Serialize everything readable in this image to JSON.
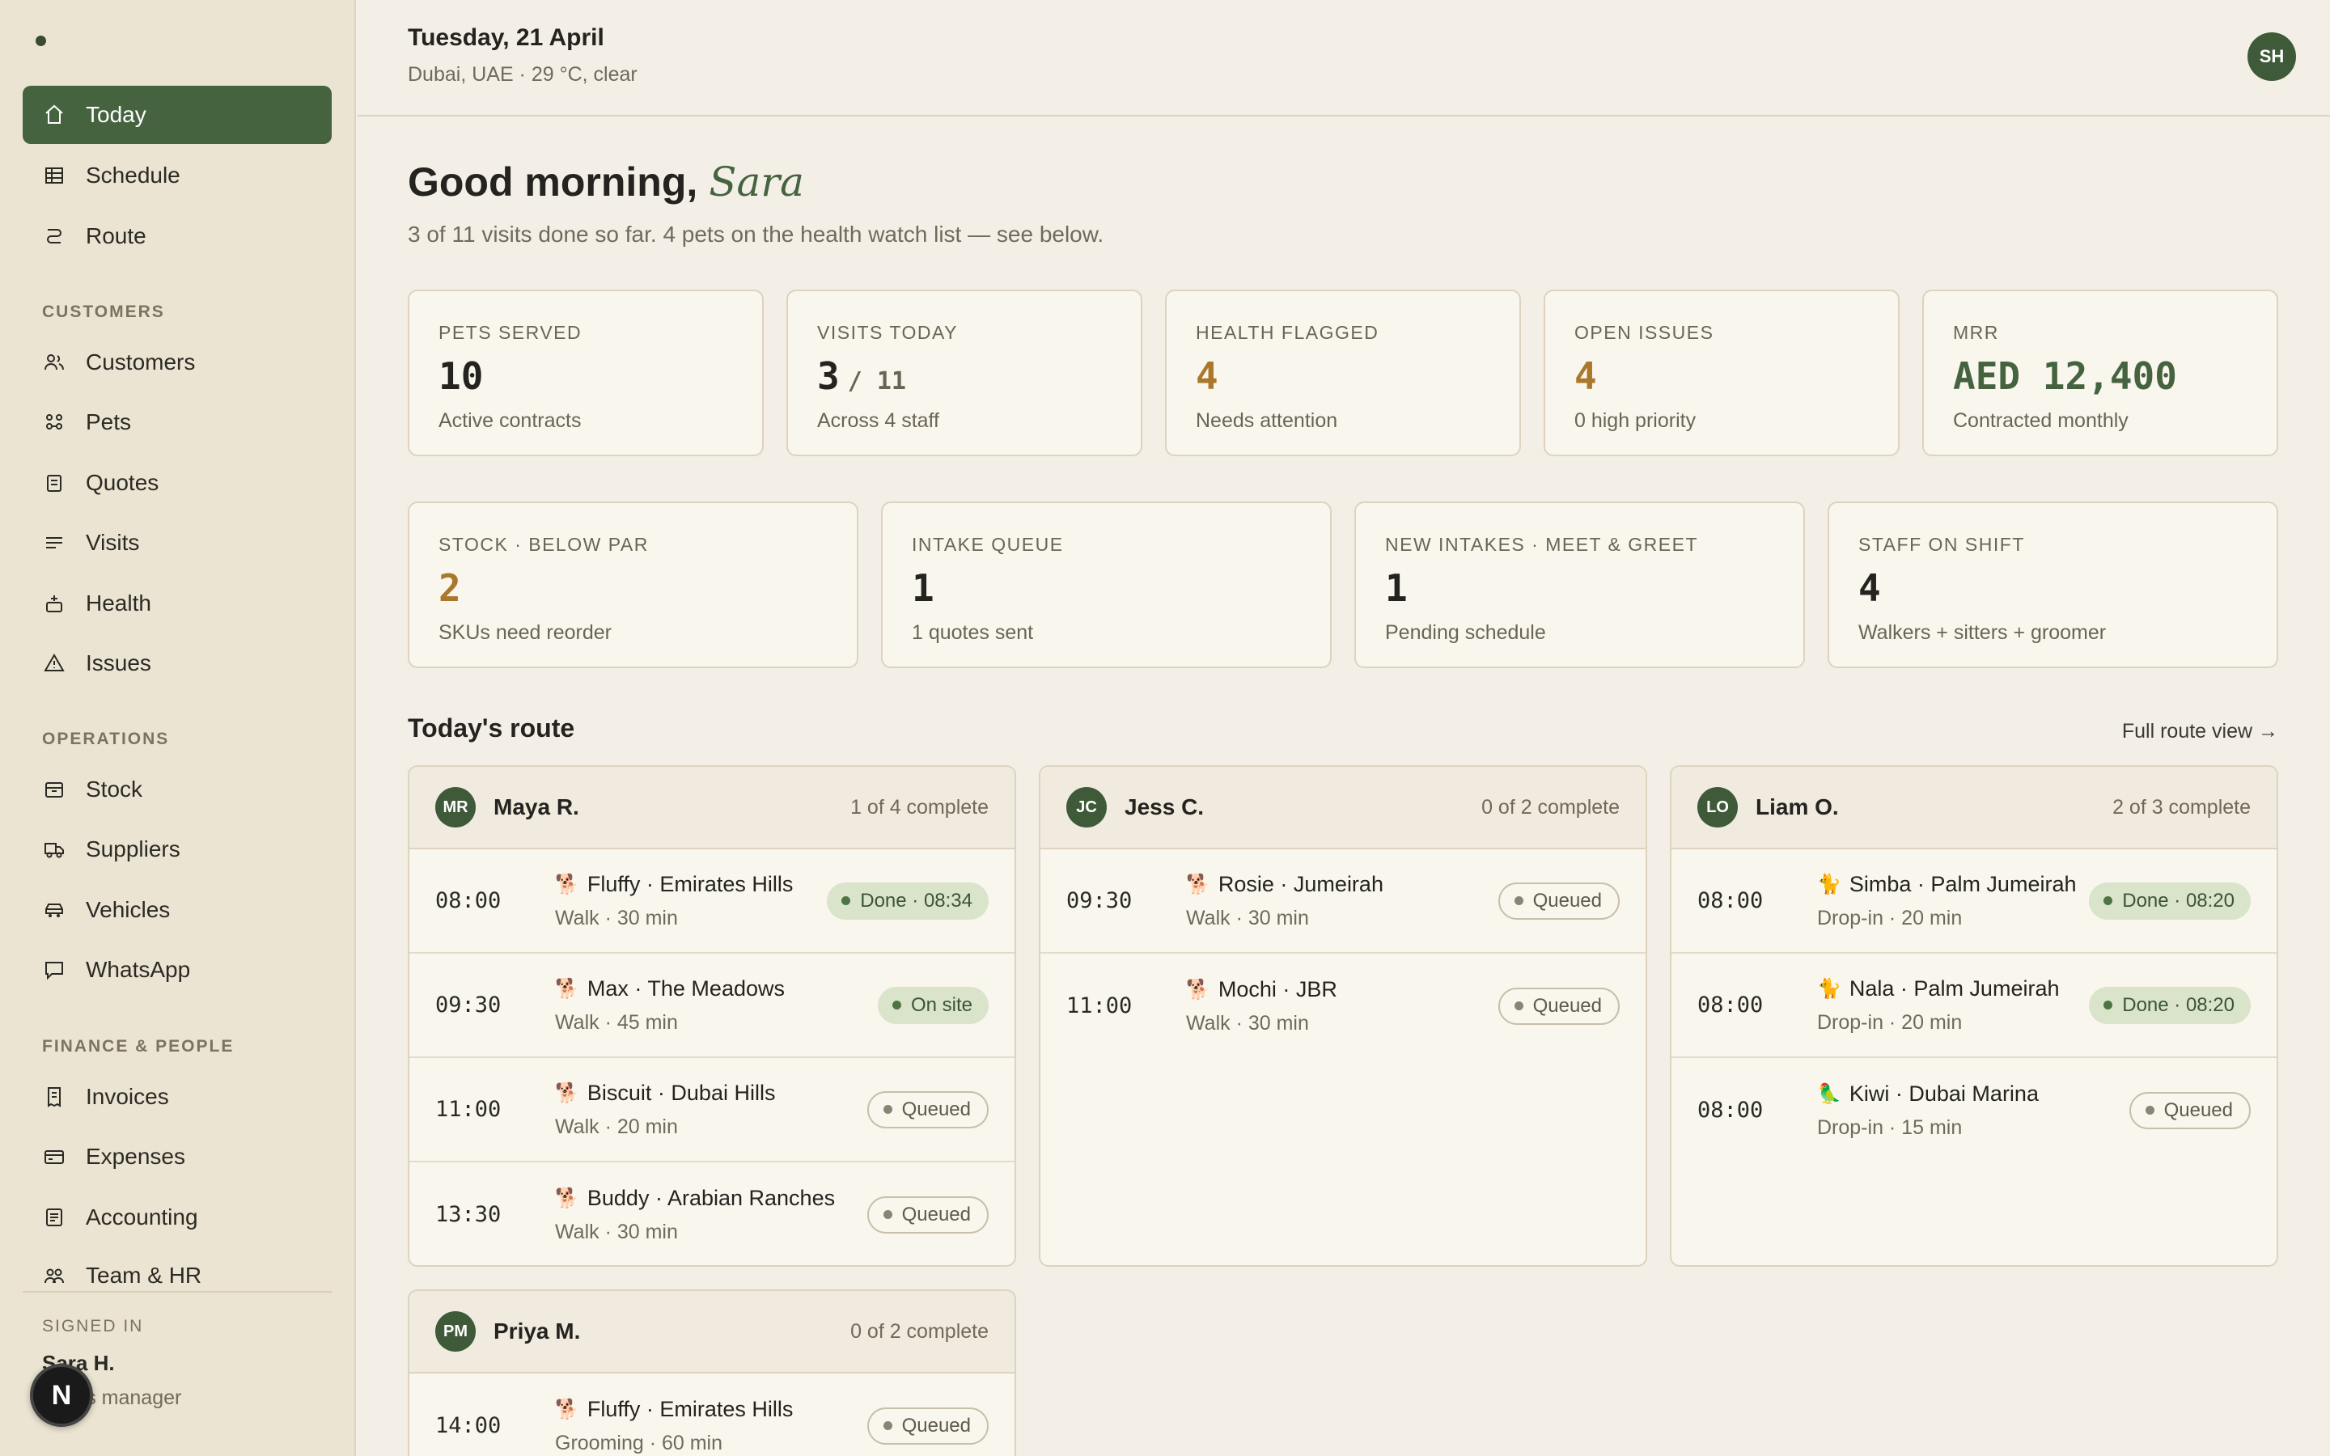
{
  "sidebar": {
    "nav_main": [
      {
        "label": "Today",
        "icon": "home-icon",
        "active": true
      },
      {
        "label": "Schedule",
        "icon": "grid-icon"
      },
      {
        "label": "Route",
        "icon": "route-icon"
      }
    ],
    "section_customers": "CUSTOMERS",
    "nav_customers": [
      {
        "label": "Customers",
        "icon": "users-icon"
      },
      {
        "label": "Pets",
        "icon": "paw-icon"
      },
      {
        "label": "Quotes",
        "icon": "clipboard-icon"
      },
      {
        "label": "Visits",
        "icon": "list-icon"
      },
      {
        "label": "Health",
        "icon": "health-icon"
      },
      {
        "label": "Issues",
        "icon": "warning-icon"
      }
    ],
    "section_operations": "OPERATIONS",
    "nav_operations": [
      {
        "label": "Stock",
        "icon": "box-icon"
      },
      {
        "label": "Suppliers",
        "icon": "truck-icon"
      },
      {
        "label": "Vehicles",
        "icon": "car-icon"
      },
      {
        "label": "WhatsApp",
        "icon": "chat-icon"
      }
    ],
    "section_finance": "FINANCE & PEOPLE",
    "nav_finance": [
      {
        "label": "Invoices",
        "icon": "receipt-icon"
      },
      {
        "label": "Expenses",
        "icon": "card-icon"
      },
      {
        "label": "Accounting",
        "icon": "ledger-icon"
      },
      {
        "label": "Team & HR",
        "icon": "team-icon"
      }
    ],
    "signed_in_label": "SIGNED IN",
    "signed_in_name": "Sara H.",
    "signed_in_role": "ations manager",
    "badge": "N"
  },
  "header": {
    "date": "Tuesday, 21 April",
    "weather": "Dubai, UAE · 29 °C, clear",
    "avatar": "SH"
  },
  "greeting": {
    "prefix": "Good morning,",
    "name": "Sara",
    "subline": "3 of 11 visits done so far. 4 pets on the health watch list — see below."
  },
  "stats_row1": [
    {
      "label": "PETS SERVED",
      "value": "10",
      "sub": "Active contracts",
      "tone": ""
    },
    {
      "label": "VISITS TODAY",
      "value": "3",
      "of": "/ 11",
      "sub": "Across 4 staff",
      "tone": ""
    },
    {
      "label": "HEALTH FLAGGED",
      "value": "4",
      "sub": "Needs attention",
      "tone": "amber"
    },
    {
      "label": "OPEN ISSUES",
      "value": "4",
      "sub": "0 high priority",
      "tone": "amber"
    },
    {
      "label": "MRR",
      "value": "AED 12,400",
      "sub": "Contracted monthly",
      "tone": "green"
    }
  ],
  "stats_row2": [
    {
      "label": "STOCK · BELOW PAR",
      "value": "2",
      "sub": "SKUs need reorder",
      "tone": "amber"
    },
    {
      "label": "INTAKE QUEUE",
      "value": "1",
      "sub": "1 quotes sent",
      "tone": ""
    },
    {
      "label": "NEW INTAKES · MEET & GREET",
      "value": "1",
      "sub": "Pending schedule",
      "tone": ""
    },
    {
      "label": "STAFF ON SHIFT",
      "value": "4",
      "sub": "Walkers + sitters + groomer",
      "tone": ""
    }
  ],
  "route": {
    "title": "Today's route",
    "link": "Full route view →",
    "staff": [
      {
        "initials": "MR",
        "name": "Maya R.",
        "progress": "1 of 4 complete",
        "visits": [
          {
            "time": "08:00",
            "pet": "🐕",
            "title": "Fluffy · Emirates Hills",
            "meta": "Walk · 30 min",
            "status": "Done · 08:34",
            "kind": "done"
          },
          {
            "time": "09:30",
            "pet": "🐕",
            "title": "Max · The Meadows",
            "meta": "Walk · 45 min",
            "status": "On site",
            "kind": "onsite"
          },
          {
            "time": "11:00",
            "pet": "🐕",
            "title": "Biscuit · Dubai Hills",
            "meta": "Walk · 20 min",
            "status": "Queued",
            "kind": "queued"
          },
          {
            "time": "13:30",
            "pet": "🐕",
            "title": "Buddy · Arabian Ranches",
            "meta": "Walk · 30 min",
            "status": "Queued",
            "kind": "queued"
          }
        ]
      },
      {
        "initials": "JC",
        "name": "Jess C.",
        "progress": "0 of 2 complete",
        "visits": [
          {
            "time": "09:30",
            "pet": "🐕",
            "title": "Rosie · Jumeirah",
            "meta": "Walk · 30 min",
            "status": "Queued",
            "kind": "queued"
          },
          {
            "time": "11:00",
            "pet": "🐕",
            "title": "Mochi · JBR",
            "meta": "Walk · 30 min",
            "status": "Queued",
            "kind": "queued"
          }
        ]
      },
      {
        "initials": "LO",
        "name": "Liam O.",
        "progress": "2 of 3 complete",
        "visits": [
          {
            "time": "08:00",
            "pet": "🐈",
            "title": "Simba · Palm Jumeirah",
            "meta": "Drop-in · 20 min",
            "status": "Done · 08:20",
            "kind": "done"
          },
          {
            "time": "08:00",
            "pet": "🐈",
            "title": "Nala · Palm Jumeirah",
            "meta": "Drop-in · 20 min",
            "status": "Done · 08:20",
            "kind": "done"
          },
          {
            "time": "08:00",
            "pet": "🦜",
            "title": "Kiwi · Dubai Marina",
            "meta": "Drop-in · 15 min",
            "status": "Queued",
            "kind": "queued"
          }
        ]
      },
      {
        "initials": "PM",
        "name": "Priya M.",
        "progress": "0 of 2 complete",
        "visits": [
          {
            "time": "14:00",
            "pet": "🐕",
            "title": "Fluffy · Emirates Hills",
            "meta": "Grooming · 60 min",
            "status": "Queued",
            "kind": "queued"
          }
        ]
      }
    ]
  },
  "colors": {
    "accent": "#466340",
    "amber": "#a9782c",
    "background": "#f3efe6",
    "sidebar": "#ece4d2"
  }
}
